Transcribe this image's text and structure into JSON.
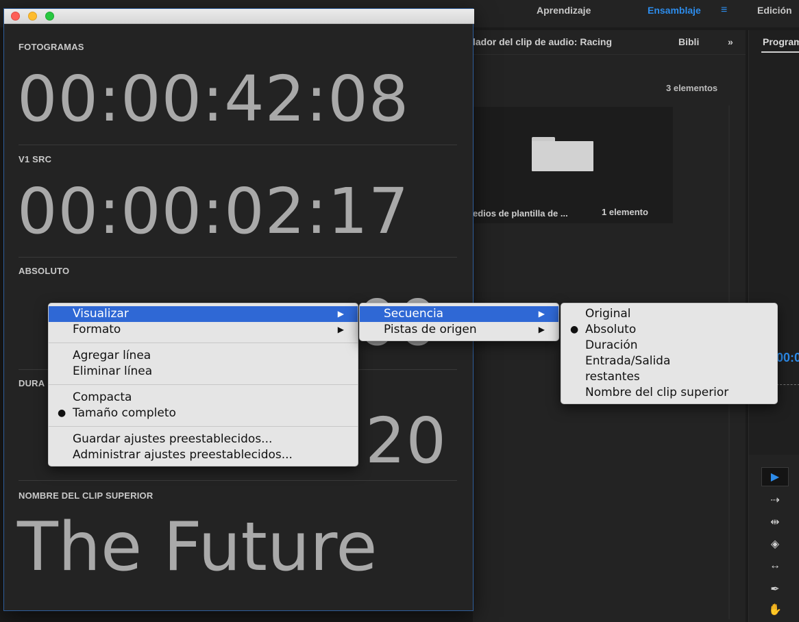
{
  "workspaces": {
    "tabs": [
      {
        "label": "Aprendizaje",
        "active": false
      },
      {
        "label": "Ensamblaje",
        "active": true
      },
      {
        "label": "Edición",
        "active": false
      }
    ],
    "menu_icon": "hamburger-icon"
  },
  "project_panel": {
    "tab_title": "lador del clip de audio: Racing",
    "tab_bibli": "Bibli",
    "overflow": "»",
    "item_count": "3 elementos",
    "bin": {
      "name": "edios de plantilla de ...",
      "count": "1 elemento",
      "icon": "folder-icon"
    }
  },
  "program_panel": {
    "tab": "Program",
    "timecode_partial": "00:0"
  },
  "tools": [
    {
      "name": "selection-tool-icon",
      "glyph": "▶",
      "selected": true
    },
    {
      "name": "track-select-tool-icon",
      "glyph": "⇢",
      "selected": false
    },
    {
      "name": "ripple-edit-tool-icon",
      "glyph": "⇹",
      "selected": false
    },
    {
      "name": "razor-tool-icon",
      "glyph": "◈",
      "selected": false
    },
    {
      "name": "slip-tool-icon",
      "glyph": "↔",
      "selected": false
    },
    {
      "name": "pen-tool-icon",
      "glyph": "✒",
      "selected": false
    },
    {
      "name": "hand-tool-icon",
      "glyph": "✋",
      "selected": false
    }
  ],
  "timecode_window": {
    "sections": [
      {
        "label": "FOTOGRAMAS",
        "value": "00:00:42:08"
      },
      {
        "label": "V1 SRC",
        "value": "00:00:02:17"
      },
      {
        "label": "ABSOLUTO",
        "value": "00"
      },
      {
        "label": "DURA",
        "value": "20"
      },
      {
        "label": "NOMBRE DEL CLIP SUPERIOR",
        "value": "The Future"
      }
    ]
  },
  "context_menu": {
    "main": [
      {
        "label": "Visualizar",
        "submenu": true,
        "highlighted": true
      },
      {
        "label": "Formato",
        "submenu": true
      },
      {
        "separator": true
      },
      {
        "label": "Agregar línea"
      },
      {
        "label": "Eliminar línea"
      },
      {
        "separator": true
      },
      {
        "label": "Compacta"
      },
      {
        "label": "Tamaño completo",
        "checked": true
      },
      {
        "separator": true
      },
      {
        "label": "Guardar ajustes preestablecidos..."
      },
      {
        "label": "Administrar ajustes preestablecidos..."
      }
    ],
    "sub": [
      {
        "label": "Secuencia",
        "submenu": true,
        "highlighted": true
      },
      {
        "label": "Pistas de origen",
        "submenu": true
      }
    ],
    "sub2": [
      {
        "label": "Original"
      },
      {
        "label": "Absoluto",
        "checked": true
      },
      {
        "label": "Duración"
      },
      {
        "label": "Entrada/Salida"
      },
      {
        "label": "restantes"
      },
      {
        "label": "Nombre del clip superior"
      }
    ]
  },
  "colors": {
    "accent": "#2d8ceb",
    "menu_highlight": "#2f68d5",
    "window_border": "#2f5e9c"
  }
}
